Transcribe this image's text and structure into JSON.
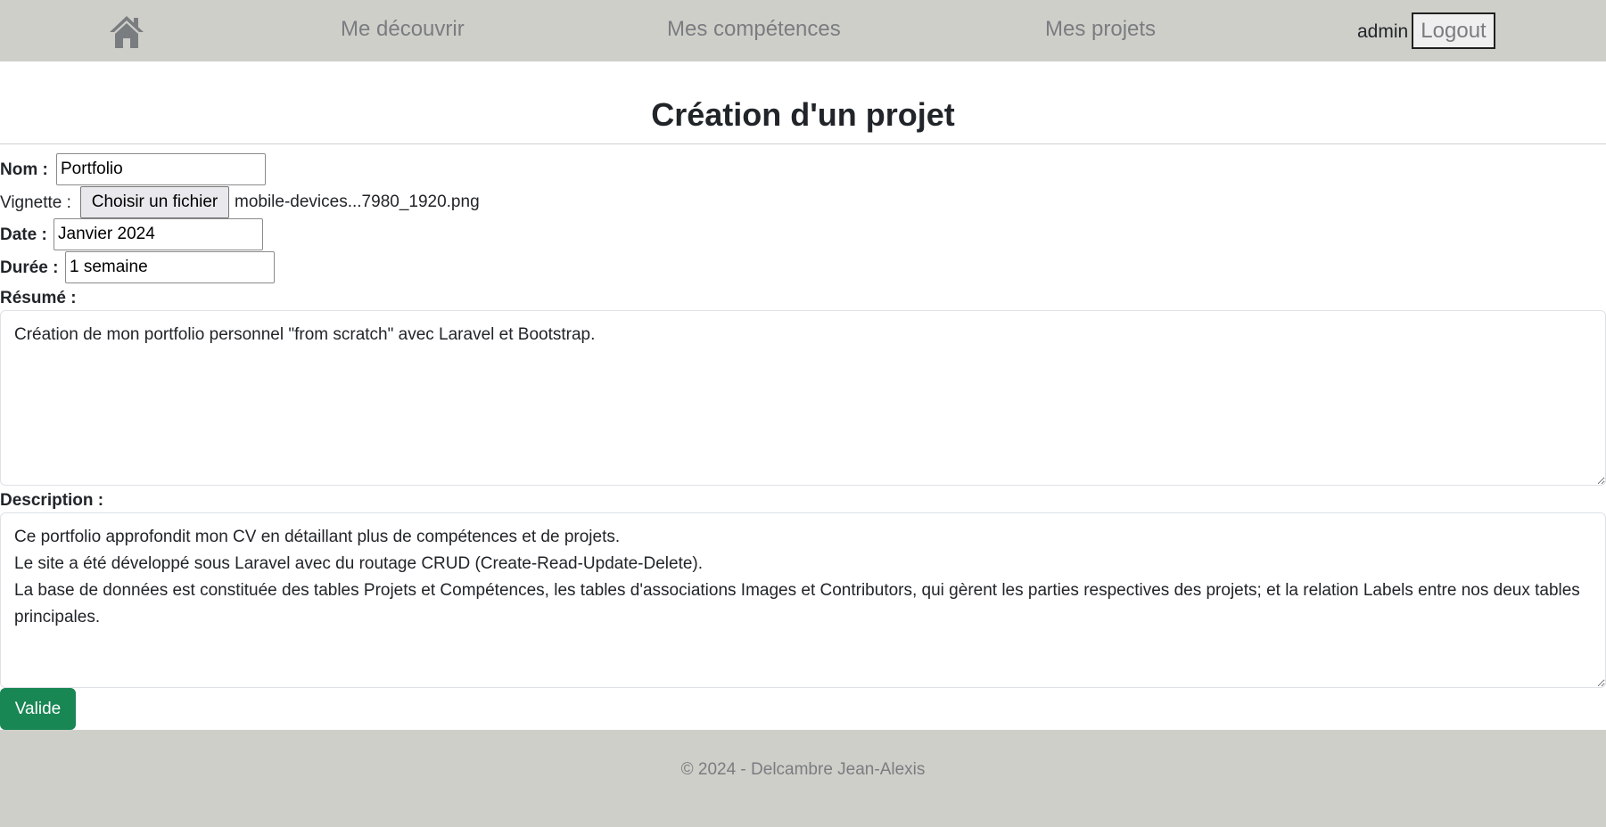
{
  "nav": {
    "home_icon": "home-icon",
    "links": [
      {
        "label": "Me découvrir"
      },
      {
        "label": "Mes compétences"
      },
      {
        "label": "Mes projets"
      }
    ],
    "user": "admin",
    "logout_label": "Logout"
  },
  "page": {
    "title": "Création d'un projet"
  },
  "form": {
    "nom_label": "Nom :",
    "nom_value": "Portfolio",
    "vignette_label": "Vignette :",
    "vignette_button": "Choisir un fichier",
    "vignette_file": "mobile-devices...7980_1920.png",
    "date_label": "Date :",
    "date_value": "Janvier 2024",
    "duree_label": "Durée :",
    "duree_value": "1 semaine",
    "resume_label": "Résumé :",
    "resume_value": "Création de mon portfolio personnel \"from scratch\" avec Laravel et Bootstrap.",
    "description_label": "Description :",
    "description_value": "Ce portfolio approfondit mon CV en détaillant plus de compétences et de projets.\nLe site a été développé sous Laravel avec du routage CRUD (Create-Read-Update-Delete).\nLa base de données est constituée des tables Projets et Compétences, les tables d'associations Images et Contributors, qui gèrent les parties respectives des projets; et la relation Labels entre nos deux tables principales.",
    "submit_label": "Valide"
  },
  "footer": {
    "text": "© 2024 - Delcambre Jean-Alexis"
  },
  "colors": {
    "navbar_bg": "#cfcfca",
    "link": "#7a7d80",
    "submit_bg": "#198754"
  }
}
